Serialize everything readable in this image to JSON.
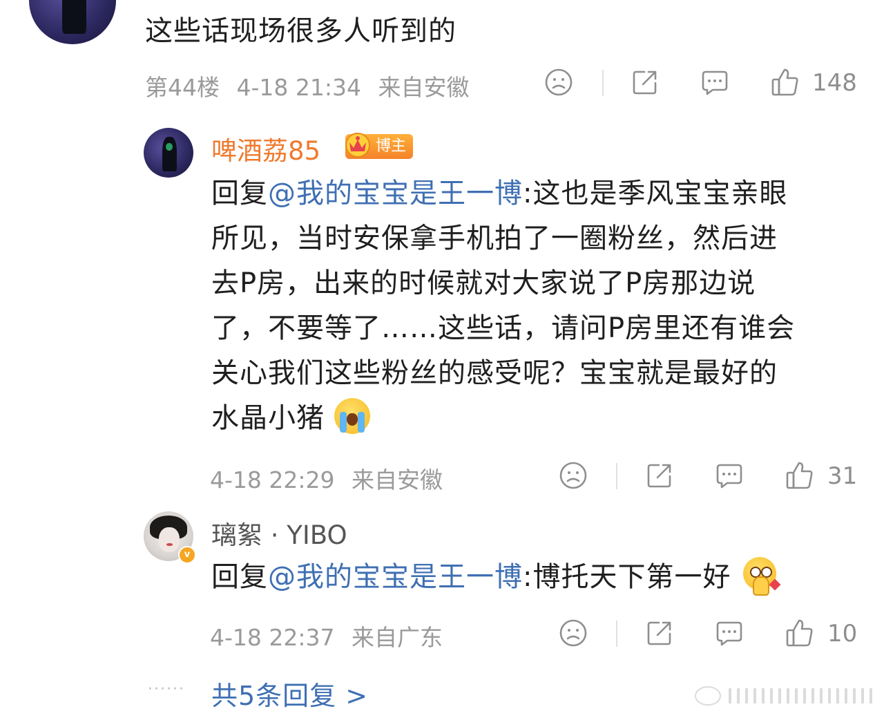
{
  "floor_comment": {
    "text": "这些话现场很多人听到的",
    "floor": "第44楼",
    "time": "4-18 21:34",
    "location": "来自安徽",
    "likes": "148"
  },
  "replies": [
    {
      "username": "啤酒荔85",
      "badge": "博主",
      "prefix": "回复",
      "mention": "@我的宝宝是王一博",
      "line1_rest": ":这也是季风宝宝亲眼",
      "lines": [
        "所见，当时安保拿手机拍了一圈粉丝，然后进",
        "去P房，出来的时候就对大家说了P房那边说",
        "了，不要等了……这些话，请问P房里还有谁会",
        "关心我们这些粉丝的感受呢？宝宝就是最好的",
        "水晶小猪"
      ],
      "emoji": "crying-face-emoji",
      "time": "4-18 22:29",
      "location": "来自安徽",
      "likes": "31"
    },
    {
      "username": "璃絮 · YIBO",
      "prefix": "回复",
      "mention": "@我的宝宝是王一博",
      "rest": ":博托天下第一好",
      "emoji": "pleading-face-emoji",
      "time": "4-18 22:37",
      "location": "来自广东",
      "likes": "10"
    }
  ],
  "more_replies": {
    "dots": "······",
    "label": "共5条回复 >"
  },
  "colors": {
    "username_highlight": "#ef7a2e",
    "mention": "#3f6fb3",
    "meta": "#9a9a9a"
  }
}
